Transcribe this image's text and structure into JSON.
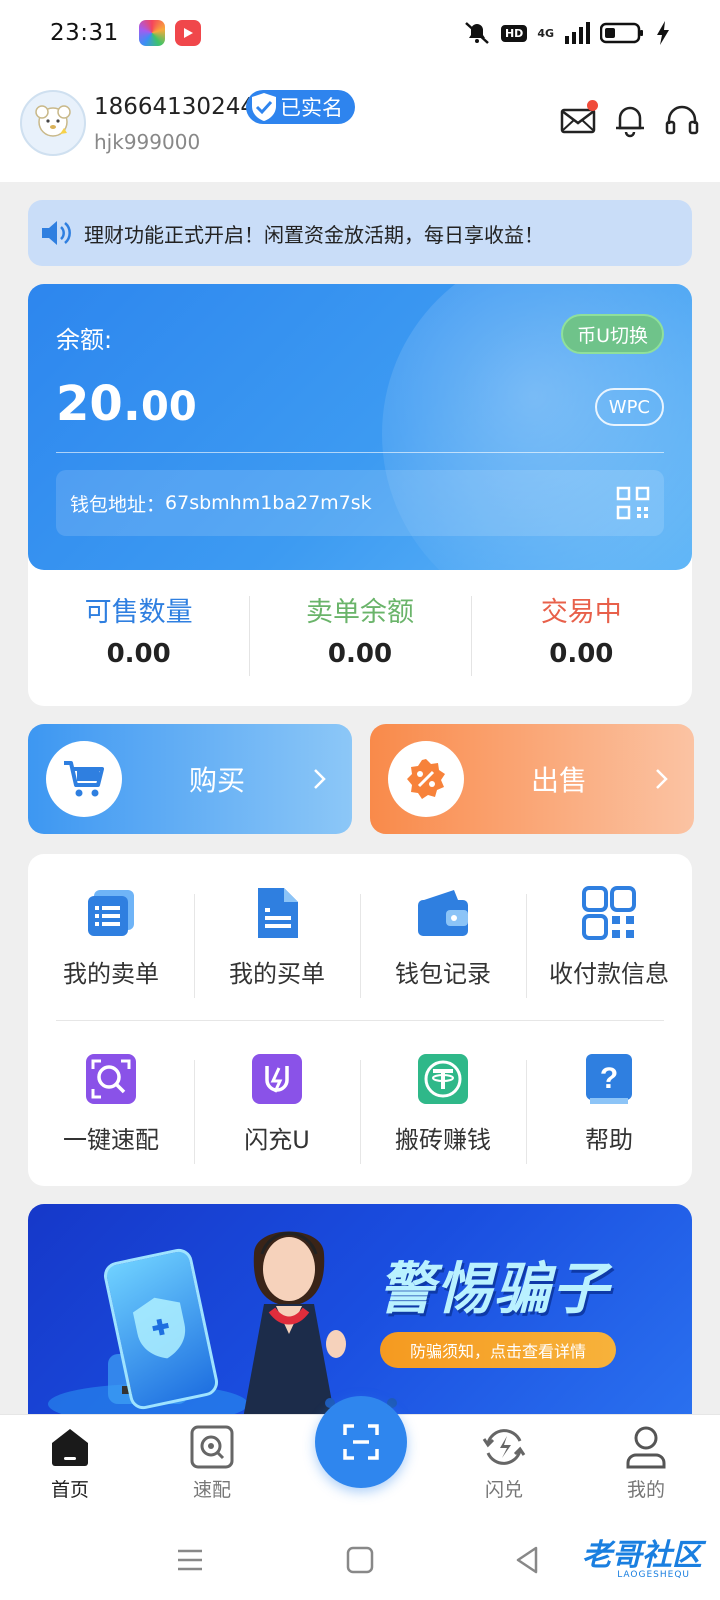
{
  "status_bar": {
    "time": "23:31",
    "hd_label": "HD",
    "network_label": "4G"
  },
  "header": {
    "phone": "18664130244",
    "verified_label": "已实名",
    "username": "hjk999000"
  },
  "notice": {
    "text": "理财功能正式开启！闲置资金放活期，每日享收益！"
  },
  "balance": {
    "label": "余额:",
    "value_int": "20.",
    "value_dec": "00",
    "switch_label": "币U切换",
    "currency_label": "WPC",
    "wallet_label": "钱包地址：",
    "wallet_address": "67sbmhm1ba27m7sk"
  },
  "stats": [
    {
      "label": "可售数量",
      "value": "0.00",
      "color": "#2f7fe0"
    },
    {
      "label": "卖单余额",
      "value": "0.00",
      "color": "#6ab46a"
    },
    {
      "label": "交易中",
      "value": "0.00",
      "color": "#e8604a"
    }
  ],
  "trade": {
    "buy_label": "购买",
    "sell_label": "出售"
  },
  "menu": [
    {
      "label": "我的卖单",
      "icon": "sell-orders-icon"
    },
    {
      "label": "我的买单",
      "icon": "buy-orders-icon"
    },
    {
      "label": "钱包记录",
      "icon": "wallet-icon"
    },
    {
      "label": "收付款信息",
      "icon": "qr-code-icon"
    },
    {
      "label": "一键速配",
      "icon": "quick-match-icon"
    },
    {
      "label": "闪充U",
      "icon": "flash-charge-icon"
    },
    {
      "label": "搬砖赚钱",
      "icon": "tether-icon"
    },
    {
      "label": "帮助",
      "icon": "help-icon"
    }
  ],
  "banner": {
    "title": "警惕骗子",
    "subtitle": "防骗须知，点击查看详情"
  },
  "bottom_nav": [
    {
      "label": "首页",
      "icon": "home-icon",
      "active": true
    },
    {
      "label": "速配",
      "icon": "quick-match-icon",
      "active": false
    },
    {
      "label": "闪兑",
      "icon": "flash-exchange-icon",
      "active": false
    },
    {
      "label": "我的",
      "icon": "profile-icon",
      "active": false
    }
  ],
  "watermark": {
    "text": "老哥社区",
    "sub": "LAOGESHEQU"
  },
  "colors": {
    "primary": "#2f86ee",
    "sell_orange": "#f98a4a",
    "alert_red": "#f04b3a"
  }
}
